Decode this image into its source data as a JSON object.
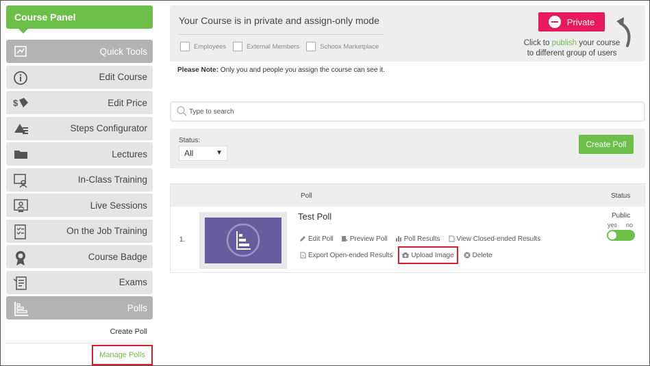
{
  "sidebar": {
    "header": "Course Panel",
    "items": [
      {
        "label": "Quick Tools",
        "icon": "quick-tools-icon",
        "active": true
      },
      {
        "label": "Edit Course",
        "icon": "info-icon"
      },
      {
        "label": "Edit Price",
        "icon": "price-icon"
      },
      {
        "label": "Steps Configurator",
        "icon": "steps-icon"
      },
      {
        "label": "Lectures",
        "icon": "folder-icon"
      },
      {
        "label": "In-Class Training",
        "icon": "in-class-icon"
      },
      {
        "label": "Live Sessions",
        "icon": "live-session-icon"
      },
      {
        "label": "On the Job Training",
        "icon": "checklist-icon"
      },
      {
        "label": "Course Badge",
        "icon": "badge-icon"
      },
      {
        "label": "Exams",
        "icon": "exam-icon"
      },
      {
        "label": "Polls",
        "icon": "polls-icon",
        "active": true
      }
    ],
    "sub_items": [
      "Create Poll",
      "Manage Polls"
    ]
  },
  "mode": {
    "title": "Your Course is in private and assign-only mode",
    "checks": [
      "Employees",
      "External Members",
      "Schoox Marketplace"
    ],
    "private_label": "Private",
    "note_pre": "Click to ",
    "note_link": "publish",
    "note_post": " your course to different group of users"
  },
  "please_note": {
    "bold": "Please Note:",
    "text": " Only you and people you assign the course can see it."
  },
  "search": {
    "placeholder": "Type to search"
  },
  "filter": {
    "status_label": "Status:",
    "status_value": "All",
    "create_label": "Create Poll"
  },
  "table": {
    "col_poll": "Poll",
    "col_status": "Status",
    "rows": [
      {
        "num": "1.",
        "title": "Test Poll",
        "actions_line1": [
          "Edit Poll",
          "Preview Poll",
          "Poll Results",
          "View Closed-ended Results"
        ],
        "actions_line2": [
          "Export Open-ended Results",
          "Upload Image",
          "Delete"
        ],
        "public_label": "Public",
        "yes": "yes",
        "no": "no"
      }
    ]
  },
  "colors": {
    "accent": "#6cc04a",
    "private": "#e8195f",
    "highlight": "#e01c2a",
    "thumb": "#665d9e"
  }
}
